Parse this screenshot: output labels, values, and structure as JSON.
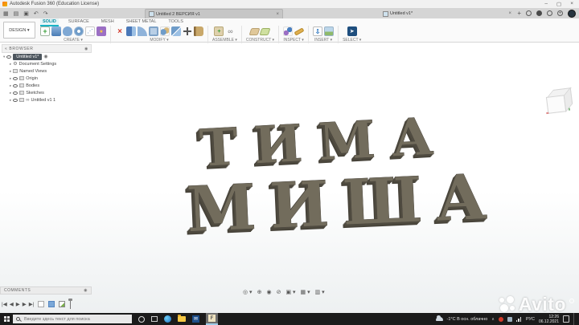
{
  "titlebar": {
    "title": "Autodesk Fusion 360 (Education License)",
    "min": "–",
    "max": "▢",
    "close": "×"
  },
  "glyphs": {
    "menu": "▦",
    "file": "▤",
    "save": "▣",
    "undo": "↶",
    "redo": "↷",
    "caret": "▾",
    "close": "×",
    "add": "+",
    "joint": "∞",
    "link": "∞",
    "gear": "⚙",
    "folder": "▤",
    "doc": "▢",
    "tri": "▸",
    "tri_open": "▾",
    "spline": "⋰",
    "star": "★",
    "delete": "×",
    "insert_arrow": "⇩",
    "select_cursor": "➤",
    "sketch_plus": "+",
    "component_plus": "+",
    "collapse": "«"
  },
  "tabs": {
    "doc1": "Untitled 2 ВЕРСИЯ v1",
    "doc2": "Untitled v1*"
  },
  "ribbon": {
    "design": "DESIGN ▾",
    "tabs": [
      "SOLID",
      "SURFACE",
      "MESH",
      "SHEET METAL",
      "TOOLS"
    ],
    "groups": {
      "create": "CREATE ▾",
      "modify": "MODIFY ▾",
      "assemble": "ASSEMBLE ▾",
      "construct": "CONSTRUCT ▾",
      "inspect": "INSPECT ▾",
      "insert": "INSERT ▾",
      "select": "SELECT ▾"
    }
  },
  "browser": {
    "header": "BROWSER",
    "root": "Untitled v1*",
    "items": [
      {
        "label": "Document Settings"
      },
      {
        "label": "Named Views"
      },
      {
        "label": "Origin"
      },
      {
        "label": "Bodies"
      },
      {
        "label": "Sketches"
      },
      {
        "label": "Untitled v1 1"
      }
    ]
  },
  "canvas": {
    "line1": "ТИМА",
    "line2": "МИША",
    "text_color": "#726c5c"
  },
  "comments": {
    "label": "COMMENTS"
  },
  "timeline": {
    "controls": [
      "|◀",
      "◀",
      "▶",
      "▶",
      "▶|"
    ]
  },
  "viewport_nav": {
    "items": [
      "◎ ▾",
      "⊕",
      "◉",
      "⊘",
      "▣ ▾",
      "▦ ▾",
      "▥ ▾"
    ]
  },
  "taskbar": {
    "search_placeholder": "Введите здесь текст для поиска",
    "weather": {
      "temp": "-1°C",
      "desc": "В осн. облачно"
    },
    "lang": "РУС",
    "time": "12:26",
    "date": "06.12.2021"
  },
  "watermark": {
    "label": "Avito"
  },
  "colors": {
    "accent_teal": "#1ab4c5",
    "select_blue": "#1e4e7e",
    "taskbar": "#1b1b1b"
  }
}
